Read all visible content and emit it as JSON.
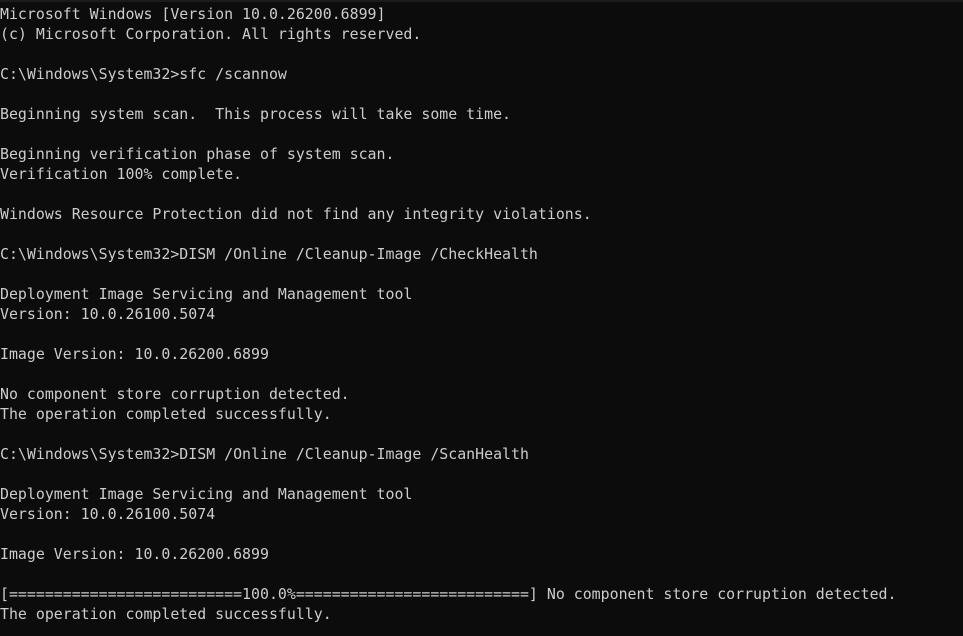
{
  "console": {
    "lines": [
      "Microsoft Windows [Version 10.0.26200.6899]",
      "(c) Microsoft Corporation. All rights reserved.",
      "",
      "C:\\Windows\\System32>sfc /scannow",
      "",
      "Beginning system scan.  This process will take some time.",
      "",
      "Beginning verification phase of system scan.",
      "Verification 100% complete.",
      "",
      "Windows Resource Protection did not find any integrity violations.",
      "",
      "C:\\Windows\\System32>DISM /Online /Cleanup-Image /CheckHealth",
      "",
      "Deployment Image Servicing and Management tool",
      "Version: 10.0.26100.5074",
      "",
      "Image Version: 10.0.26200.6899",
      "",
      "No component store corruption detected.",
      "The operation completed successfully.",
      "",
      "C:\\Windows\\System32>DISM /Online /Cleanup-Image /ScanHealth",
      "",
      "Deployment Image Servicing and Management tool",
      "Version: 10.0.26100.5074",
      "",
      "Image Version: 10.0.26200.6899",
      "",
      "[==========================100.0%==========================] No component store corruption detected.",
      "The operation completed successfully."
    ]
  },
  "colors": {
    "background": "#0c0c0c",
    "text": "#cccccc"
  }
}
